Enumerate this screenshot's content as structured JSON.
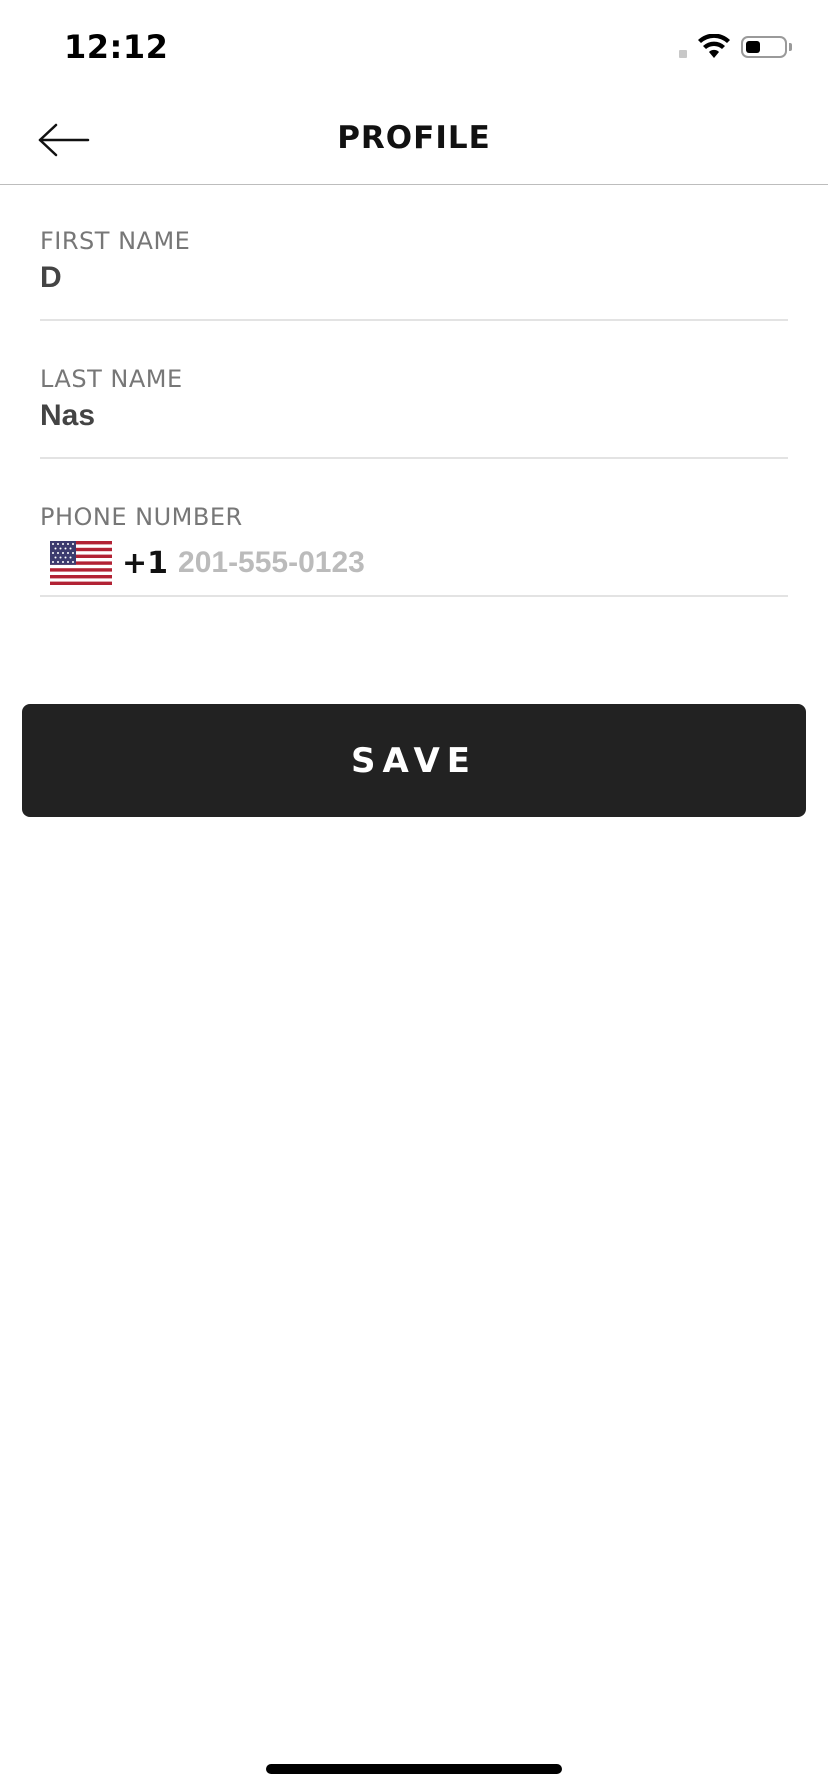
{
  "status_bar": {
    "time": "12:12",
    "battery_level": 0.4,
    "icons": [
      "signal-dot-icon",
      "wifi-icon",
      "battery-icon"
    ]
  },
  "nav": {
    "back_icon": "arrow-left-icon",
    "title": "PROFILE"
  },
  "form": {
    "first_name": {
      "label": "FIRST NAME",
      "value": "D"
    },
    "last_name": {
      "label": "LAST NAME",
      "value": "Nas"
    },
    "phone": {
      "label": "PHONE NUMBER",
      "country_icon": "us-flag-icon",
      "dial_code": "+1",
      "value": "",
      "placeholder": "201-555-0123"
    }
  },
  "save_button": {
    "label": "SAVE"
  },
  "colors": {
    "button_background": "#222222",
    "label_gray": "#777777",
    "placeholder_gray": "#bbbbbb",
    "divider": "#e3e3e3"
  }
}
